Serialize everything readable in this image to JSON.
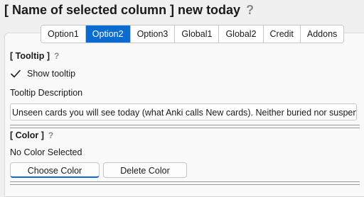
{
  "window": {
    "title": "[ Name of selected column ] new today",
    "help_icon": "?"
  },
  "tabs": [
    {
      "label": "Option1",
      "active": false
    },
    {
      "label": "Option2",
      "active": true
    },
    {
      "label": "Option3",
      "active": false
    },
    {
      "label": "Global1",
      "active": false
    },
    {
      "label": "Global2",
      "active": false
    },
    {
      "label": "Credit",
      "active": false
    },
    {
      "label": "Addons",
      "active": false
    }
  ],
  "tooltip_section": {
    "title": "[ Tooltip ]",
    "help_icon": "?",
    "show_tooltip_label": "Show tooltip",
    "show_tooltip_checked": true,
    "description_label": "Tooltip Description",
    "description_value": "Unseen cards you will see today (what Anki calls New cards). Neither buried nor suspended."
  },
  "color_section": {
    "title": "[ Color ]",
    "help_icon": "?",
    "status": "No Color Selected",
    "choose_button": "Choose Color",
    "delete_button": "Delete Color"
  },
  "colors": {
    "accent": "#0a6cd0",
    "help_icon": "#8a8a8a"
  }
}
